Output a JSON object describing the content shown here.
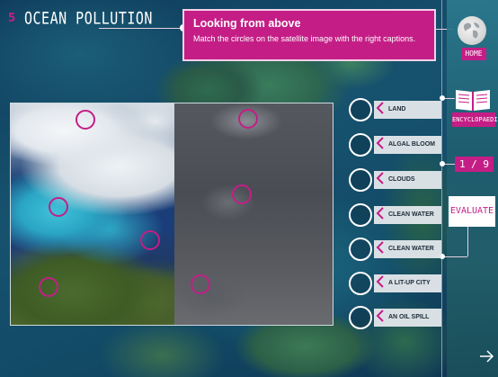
{
  "app": {
    "section_number": "5",
    "section_title": "OCEAN POLLUTION"
  },
  "instruction": {
    "title": "Looking from above",
    "text": "Match the circles on the satellite image with the right captions."
  },
  "sidebar": {
    "home_label": "HOME",
    "encyclopedia_label": "ENCYCLOPAEDIA",
    "page_counter": "1 / 9",
    "evaluate_label": "EVALUATE",
    "next_icon": "arrow-right-icon"
  },
  "captions": [
    {
      "label": "LAND"
    },
    {
      "label": "ALGAL BLOOM"
    },
    {
      "label": "CLOUDS"
    },
    {
      "label": "CLEAN WATER"
    },
    {
      "label": "CLEAN WATER"
    },
    {
      "label": "A LIT-UP CITY"
    },
    {
      "label": "AN OIL SPILL"
    }
  ],
  "colors": {
    "accent": "#c41e86",
    "caption_bg": "#e4e8ec"
  }
}
